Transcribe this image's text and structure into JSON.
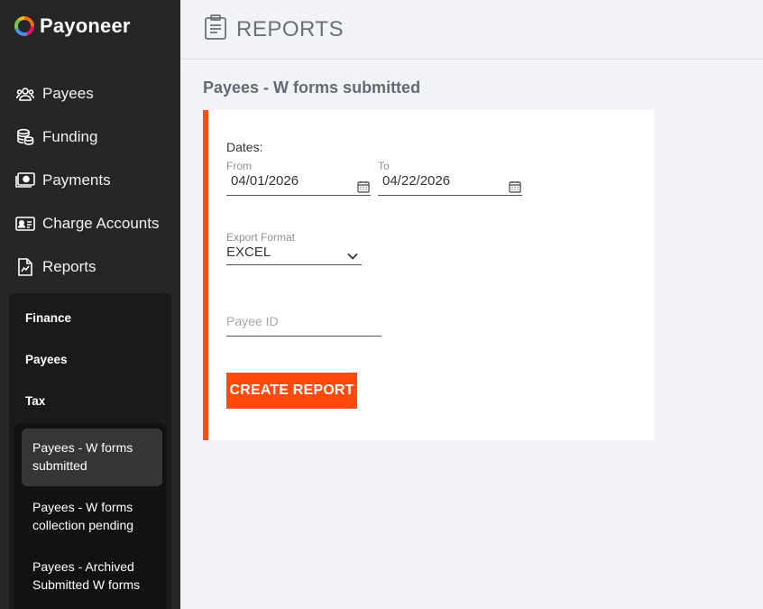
{
  "brand": {
    "name": "Payoneer"
  },
  "nav": {
    "items": [
      {
        "label": "Payees",
        "icon": "people-icon"
      },
      {
        "label": "Funding",
        "icon": "coins-icon"
      },
      {
        "label": "Payments",
        "icon": "cash-icon"
      },
      {
        "label": "Charge Accounts",
        "icon": "id-card-icon"
      },
      {
        "label": "Reports",
        "icon": "report-file-icon"
      }
    ]
  },
  "reports_menu": {
    "items": [
      "Finance",
      "Payees",
      "Tax"
    ],
    "tax_links": [
      "Payees - W forms submitted",
      "Payees - W forms collection pending",
      "Payees - Archived Submitted W forms"
    ],
    "active": "Payees - W forms submitted"
  },
  "header": {
    "title": "REPORTS"
  },
  "page": {
    "title": "Payees - W forms submitted"
  },
  "form": {
    "dates_label": "Dates:",
    "from_label": "From",
    "from_value": "04/01/2026",
    "to_label": "To",
    "to_value": "04/22/2026",
    "export_label": "Export Format",
    "export_value": "EXCEL",
    "payee_id_placeholder": "Payee ID",
    "payee_id_value": "",
    "create_button": "CREATE REPORT"
  },
  "colors": {
    "sidebar_bg": "#262626",
    "accent": "#ff4a0c",
    "card_border": "#f25017",
    "page_bg": "#f2f3f6"
  }
}
